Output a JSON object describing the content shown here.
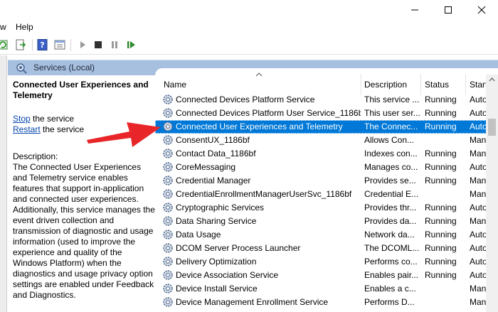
{
  "menu": {
    "view_partial": "w",
    "help": "Help"
  },
  "header": {
    "title": "Services (Local)"
  },
  "selected_service": {
    "name": "Connected User Experiences and Telemetry",
    "stop_link": "Stop",
    "stop_suffix": " the service",
    "restart_link": "Restart",
    "restart_suffix": " the service",
    "description_label": "Description:",
    "description": "The Connected User Experiences and Telemetry service enables features that support in-application and connected user experiences. Additionally, this service manages the event driven collection and transmission of diagnostic and usage information (used to improve the experience and quality of the Windows Platform) when the diagnostics and usage privacy option settings are enabled under Feedback and Diagnostics."
  },
  "columns": {
    "name": "Name",
    "description": "Description",
    "status": "Status",
    "startup": "Start"
  },
  "services": [
    {
      "name": "Connected Devices Platform Service",
      "description": "This service ...",
      "status": "Running",
      "startup": "Auto"
    },
    {
      "name": "Connected Devices Platform User Service_1186bf",
      "description": "This user ser...",
      "status": "Running",
      "startup": "Auto"
    },
    {
      "name": "Connected User Experiences and Telemetry",
      "description": "The Connec...",
      "status": "Running",
      "startup": "Auto",
      "selected": true
    },
    {
      "name": "ConsentUX_1186bf",
      "description": "Allows Con...",
      "status": "",
      "startup": "Man"
    },
    {
      "name": "Contact Data_1186bf",
      "description": "Indexes con...",
      "status": "Running",
      "startup": "Man"
    },
    {
      "name": "CoreMessaging",
      "description": "Manages co...",
      "status": "Running",
      "startup": "Auto"
    },
    {
      "name": "Credential Manager",
      "description": "Provides se...",
      "status": "Running",
      "startup": "Man"
    },
    {
      "name": "CredentialEnrollmentManagerUserSvc_1186bf",
      "description": "Credential E...",
      "status": "",
      "startup": "Man"
    },
    {
      "name": "Cryptographic Services",
      "description": "Provides thr...",
      "status": "Running",
      "startup": "Auto"
    },
    {
      "name": "Data Sharing Service",
      "description": "Provides da...",
      "status": "Running",
      "startup": "Man"
    },
    {
      "name": "Data Usage",
      "description": "Network da...",
      "status": "Running",
      "startup": "Auto"
    },
    {
      "name": "DCOM Server Process Launcher",
      "description": "The DCOML...",
      "status": "Running",
      "startup": "Auto"
    },
    {
      "name": "Delivery Optimization",
      "description": "Performs co...",
      "status": "Running",
      "startup": "Auto"
    },
    {
      "name": "Device Association Service",
      "description": "Enables pair...",
      "status": "Running",
      "startup": "Auto"
    },
    {
      "name": "Device Install Service",
      "description": "Enables a c...",
      "status": "",
      "startup": "Man"
    },
    {
      "name": "Device Management Enrollment Service",
      "description": "Performs D...",
      "status": "",
      "startup": "Man"
    }
  ],
  "colors": {
    "selection": "#0078d7",
    "header_band": "#a8c0e0",
    "link": "#0645ad",
    "arrow": "#e8262a"
  }
}
